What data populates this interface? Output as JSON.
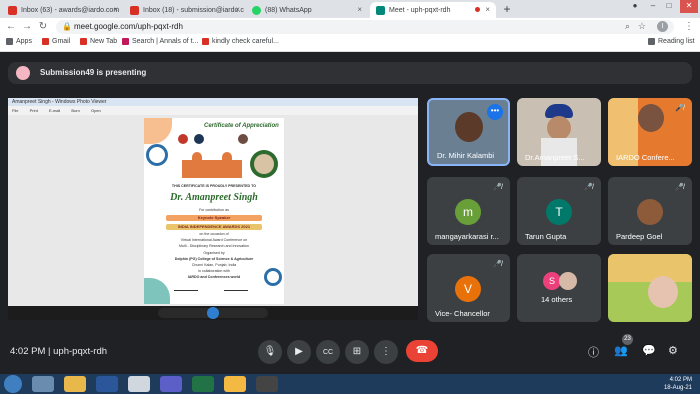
{
  "browser": {
    "tabs": [
      {
        "label": "Inbox (63) - awards@iardo.com",
        "fav_color": "#d93025"
      },
      {
        "label": "Inbox (18) - submission@iardo.c",
        "fav_color": "#d93025"
      },
      {
        "label": "(88) WhatsApp",
        "fav_color": "#25d366"
      },
      {
        "label": "Meet - uph-pqxt-rdh",
        "fav_color": "#00897b"
      }
    ],
    "url": "meet.google.com/uph-pqxt-rdh",
    "profile_initial": "I",
    "bookmarks": [
      {
        "label": "Apps",
        "color": "#5f6368"
      },
      {
        "label": "Gmail",
        "color": "#d93025"
      },
      {
        "label": "New Tab",
        "color": "#d93025"
      },
      {
        "label": "Search | Annals of t...",
        "color": "#c2185b"
      },
      {
        "label": "kindly check careful...",
        "color": "#d93025"
      }
    ],
    "reading_list": "Reading list"
  },
  "meet": {
    "presenting_text": "Submission49 is presenting",
    "meeting_time": "4:02 PM",
    "meeting_code": "uph-pqxt-rdh",
    "participant_count": "23",
    "shared": {
      "window_title": "Amanpreet Singh - Windows Photo Viewer",
      "menu": [
        "File",
        "Print",
        "E-mail",
        "Burn",
        "Open"
      ],
      "cert_title": "Certificate of Appreciation",
      "presented_to": "THIS CERTIFICATE IS PROUDLY PRESENTED TO",
      "recipient": "Dr. Amanpreet Singh",
      "for_contribution": "For contribution as",
      "role": "Keynote Speaker",
      "award": "INDIA INDEPENDENCE AWARDS 2021",
      "occasion": "on the occasion of",
      "conference_1": "Virtual International Award Conference on",
      "conference_2": "Multi - Disciplinary Research and Innovation",
      "organised_by": "Organised by",
      "college": "Dolphin (PG) College of Science & Agriculture",
      "address": "Chunni Kalan, Punjab, India",
      "collab": "in collaboration with",
      "collab_org": "IARDO and Conferences world"
    },
    "participants": [
      {
        "name": "Dr. Mihir Kalambi"
      },
      {
        "name": "Dr.Amanpreet S..."
      },
      {
        "name": "IARDO Confere..."
      },
      {
        "name": "mangayarkarasi r...",
        "initial": "m",
        "color": "#689f38"
      },
      {
        "name": "Tarun Gupta",
        "initial": "T",
        "color": "#00796b"
      },
      {
        "name": "Pardeep Goel"
      },
      {
        "name": "Vice- Chancellor",
        "initial": "V",
        "color": "#e8710a"
      },
      {
        "name": "14 others",
        "initial": "S",
        "color": "#ec407a"
      },
      {
        "name": ""
      }
    ]
  },
  "taskbar": {
    "time": "4:02 PM",
    "date": "18-Aug-21"
  }
}
